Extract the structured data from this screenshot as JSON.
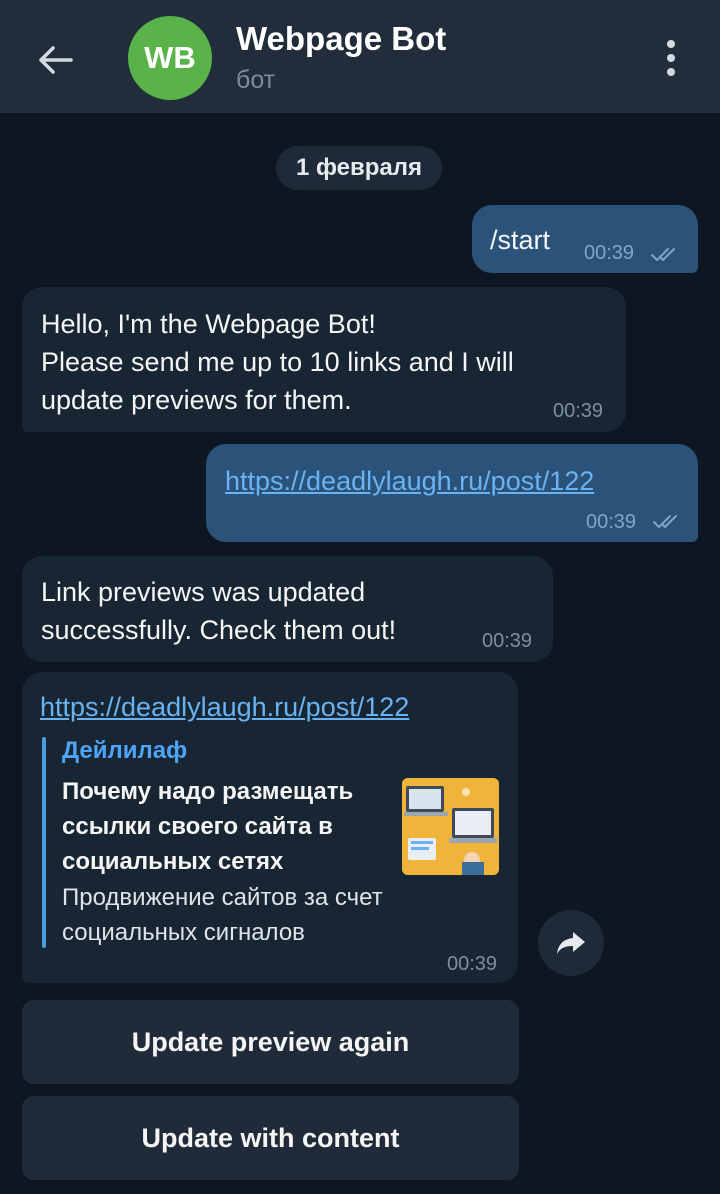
{
  "header": {
    "avatar_initials": "WB",
    "avatar_color": "#5ab348",
    "title": "Webpage Bot",
    "subtitle": "бот"
  },
  "date_separator": "1 февраля",
  "messages": [
    {
      "direction": "out",
      "text": "/start",
      "time": "00:39",
      "read": true
    },
    {
      "direction": "in",
      "text": "Hello, I'm the Webpage Bot!\nPlease send me up to 10 links and I will\nupdate previews for them.",
      "time": "00:39"
    },
    {
      "direction": "out",
      "text": "https://deadlylaugh.ru/post/122",
      "time": "00:39",
      "read": true
    },
    {
      "direction": "in",
      "text": "Link previews was updated\nsuccessfully. Check them out!",
      "time": "00:39"
    },
    {
      "direction": "in",
      "text": "https://deadlylaugh.ru/post/122",
      "time": "00:39",
      "preview": {
        "site_name": "Дейлилаф",
        "title": "Почему надо размещать\nссылки своего сайта в\nсоциальных сетях",
        "description": "Продвижение сайтов за счет\nсоциальных сигналов",
        "thumbnail_icon": "laptop-illustration"
      }
    }
  ],
  "keyboard_buttons": [
    "Update preview again",
    "Update with content"
  ],
  "colors": {
    "background": "#0e1621",
    "header": "#212d3b",
    "bubble_out": "#2b5278",
    "bubble_in": "#182533",
    "link": "#6ab3f3"
  }
}
